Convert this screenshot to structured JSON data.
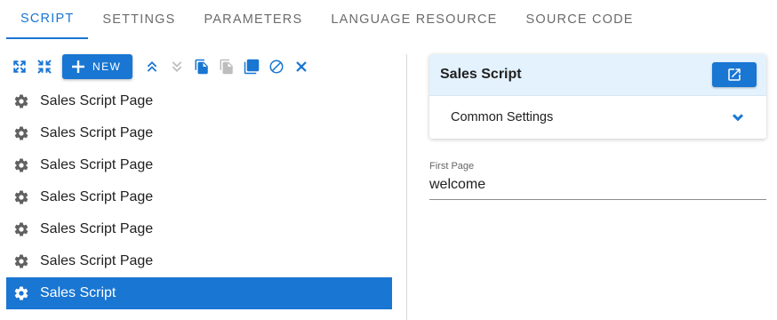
{
  "tabs": [
    {
      "label": "SCRIPT",
      "active": true
    },
    {
      "label": "SETTINGS",
      "active": false
    },
    {
      "label": "PARAMETERS",
      "active": false
    },
    {
      "label": "LANGUAGE RESOURCE",
      "active": false
    },
    {
      "label": "SOURCE CODE",
      "active": false
    }
  ],
  "toolbar": {
    "new_label": "NEW",
    "icons": [
      "expand-all-icon",
      "collapse-all-icon",
      "add-icon",
      "move-up-icon",
      "move-down-icon",
      "copy-icon",
      "paste-icon",
      "duplicate-icon",
      "block-icon",
      "close-icon"
    ]
  },
  "tree": {
    "items": [
      {
        "label": "Sales Script Page",
        "selected": false
      },
      {
        "label": "Sales Script Page",
        "selected": false
      },
      {
        "label": "Sales Script Page",
        "selected": false
      },
      {
        "label": "Sales Script Page",
        "selected": false
      },
      {
        "label": "Sales Script Page",
        "selected": false
      },
      {
        "label": "Sales Script Page",
        "selected": false
      },
      {
        "label": "Sales Script",
        "selected": true
      }
    ]
  },
  "panel": {
    "title": "Sales Script",
    "section_label": "Common Settings"
  },
  "field": {
    "label": "First Page",
    "value": "welcome"
  },
  "colors": {
    "accent": "#1976d2",
    "panel_header_bg": "#e3f2fd",
    "disabled_icon": "#9e9e9e",
    "tab_inactive": "#6b6b6b"
  }
}
